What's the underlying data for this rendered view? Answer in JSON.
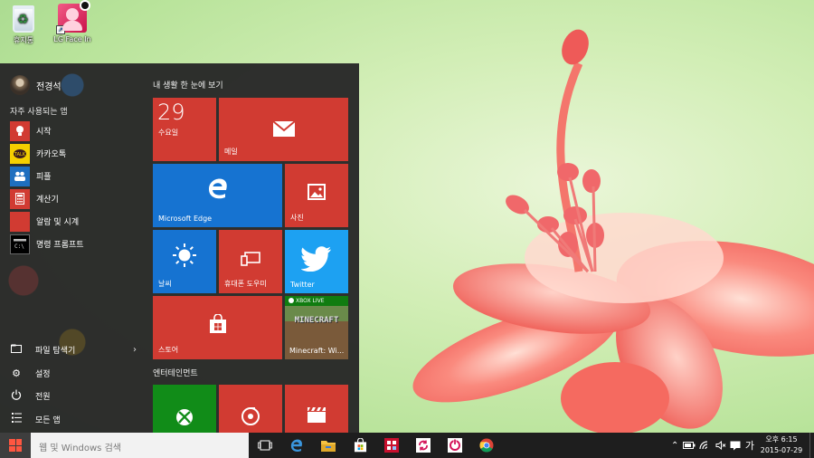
{
  "desktop": {
    "icons": [
      {
        "label": "휴지통",
        "icon": "recycle-bin-icon"
      },
      {
        "label": "LG Face In",
        "icon": "lg-face-in-icon"
      }
    ]
  },
  "start_menu": {
    "user_name": "전경석",
    "most_used_label": "자주 사용되는 앱",
    "most_used": [
      {
        "label": "시작",
        "icon": "lightbulb-icon",
        "color": "#d13b32"
      },
      {
        "label": "카카오톡",
        "icon": "kakaotalk-icon",
        "color": "#f5d000"
      },
      {
        "label": "피플",
        "icon": "people-icon",
        "color": "#1e6fbf"
      },
      {
        "label": "계산기",
        "icon": "calculator-icon",
        "color": "#d13b32"
      },
      {
        "label": "알람 및 시계",
        "icon": "alarm-clock-icon",
        "color": "#d13b32"
      },
      {
        "label": "명령 프롬프트",
        "icon": "command-prompt-icon",
        "color": "#000000"
      }
    ],
    "bottom_items": [
      {
        "label": "파일 탐색기",
        "icon": "file-explorer-icon"
      },
      {
        "label": "설정",
        "icon": "settings-gear-icon"
      },
      {
        "label": "전원",
        "icon": "power-icon"
      },
      {
        "label": "모든 앱",
        "icon": "all-apps-icon"
      }
    ],
    "group1_label": "내 생활 한 눈에 보기",
    "group2_label": "엔터테인먼트",
    "tiles": {
      "calendar": {
        "day": "29",
        "weekday": "수요일"
      },
      "mail": "메일",
      "edge": "Microsoft Edge",
      "photos": "사진",
      "weather": "날씨",
      "phone": "휴대폰 도우미",
      "twitter": "Twitter",
      "store": "스토어",
      "minecraft": {
        "label": "Minecraft: Wi...",
        "badge": "XBOX LIVE",
        "logo": "MINECRAFT"
      }
    }
  },
  "taskbar": {
    "search_placeholder": "웹 및 Windows 검색",
    "ime": "가",
    "time": "오후 6:15",
    "date": "2015-07-29"
  },
  "colors": {
    "tile_red": "#d13b32",
    "tile_blue": "#1673d1",
    "tile_green": "#118c18",
    "twitter_blue": "#1da1f2",
    "start_bg": "#282828",
    "taskbar_bg": "#1e1e1e"
  }
}
